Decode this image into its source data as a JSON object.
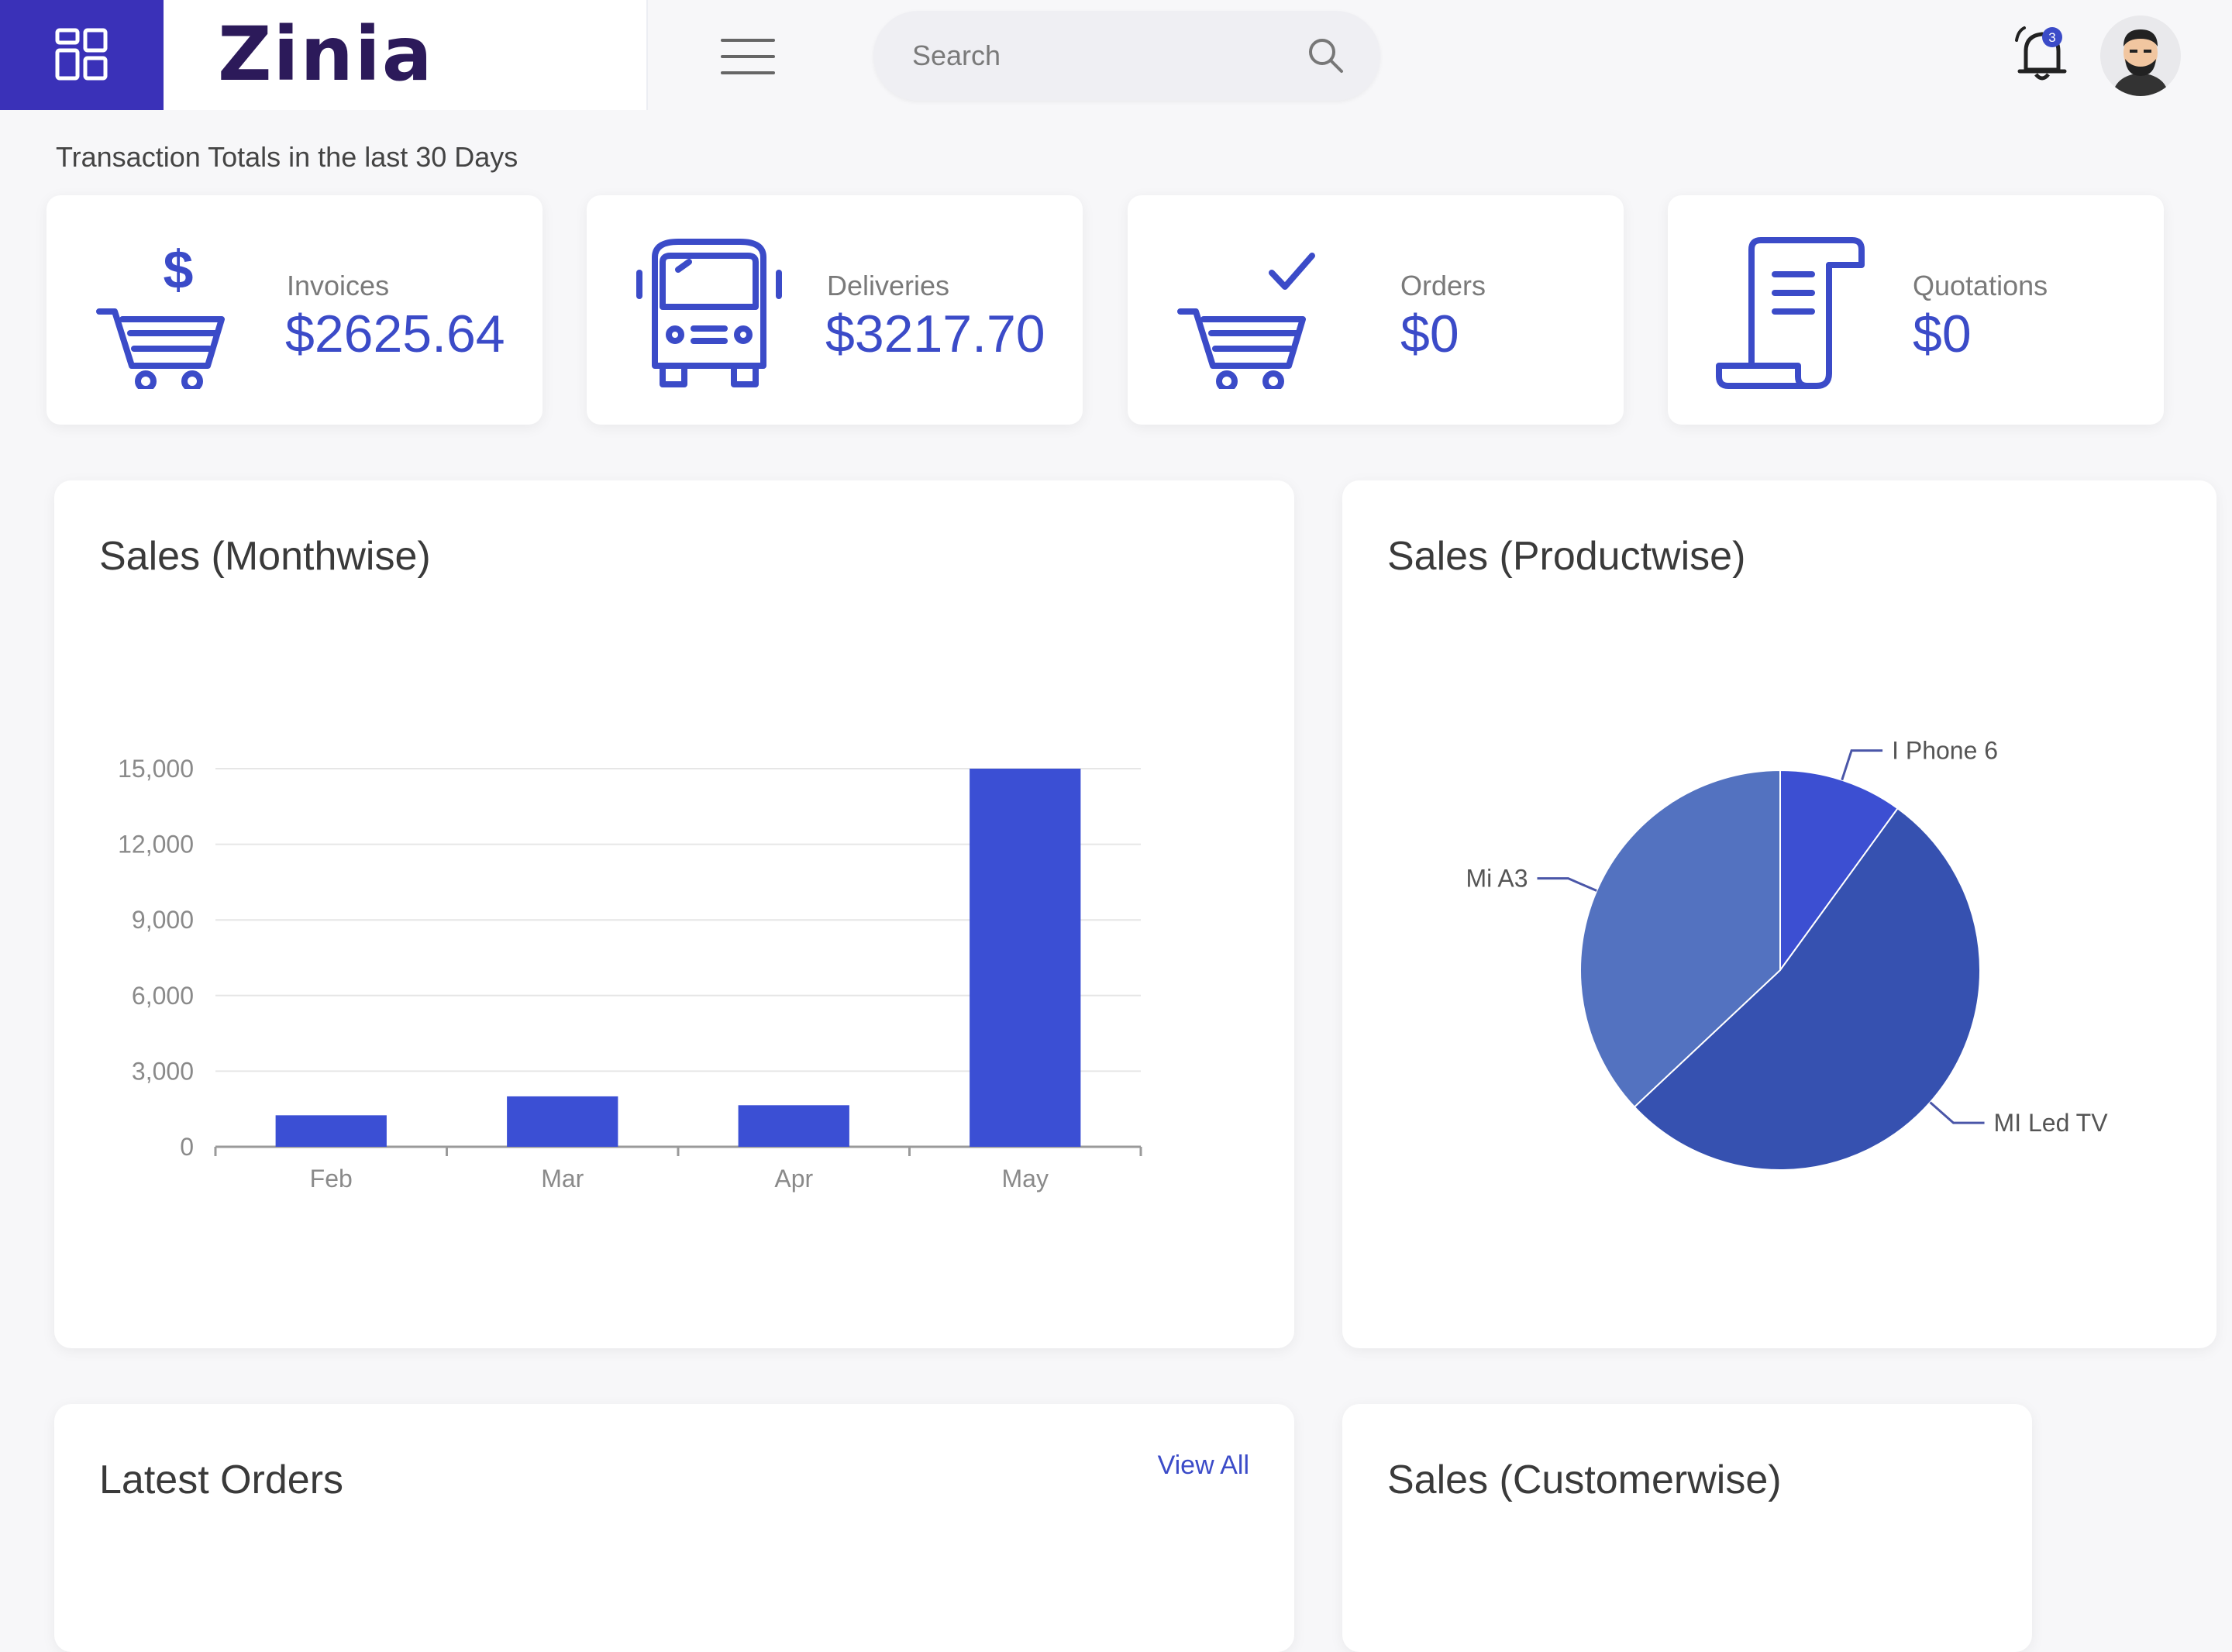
{
  "app": {
    "name": "Zinia"
  },
  "search": {
    "placeholder": "Search"
  },
  "notifications": {
    "count": "3"
  },
  "transactions": {
    "heading": "Transaction Totals in the last 30 Days",
    "cards": [
      {
        "label": "Invoices",
        "value": "$2625.64",
        "icon": "cart-dollar-icon"
      },
      {
        "label": "Deliveries",
        "value": "$3217.70",
        "icon": "truck-icon"
      },
      {
        "label": "Orders",
        "value": "$0",
        "icon": "cart-check-icon"
      },
      {
        "label": "Quotations",
        "value": "$0",
        "icon": "receipt-icon"
      }
    ]
  },
  "monthwise": {
    "title": "Sales (Monthwise)",
    "chart_data": {
      "type": "bar",
      "categories": [
        "Feb",
        "Mar",
        "Apr",
        "May"
      ],
      "values": [
        1250,
        2000,
        1650,
        15000
      ],
      "ylim": [
        0,
        15000
      ],
      "yticks": [
        "0",
        "3,000",
        "6,000",
        "9,000",
        "12,000",
        "15,000"
      ],
      "ytick_values": [
        0,
        3000,
        6000,
        9000,
        12000,
        15000
      ],
      "grid": true,
      "color": "#3b4fd4"
    }
  },
  "productwise": {
    "title": "Sales (Productwise)",
    "chart_data": {
      "type": "pie",
      "labels": [
        "I Phone 6",
        "MI Led TV",
        "Mi A3"
      ],
      "values": [
        10,
        53,
        37
      ],
      "colors": [
        "#3c4fd2",
        "#3651b0",
        "#5372c0"
      ]
    }
  },
  "latest_orders": {
    "title": "Latest Orders",
    "view_all": "View All"
  },
  "customerwise": {
    "title": "Sales (Customerwise)"
  },
  "colors": {
    "brand": "#3a31b8",
    "accent": "#3b4bc8"
  }
}
